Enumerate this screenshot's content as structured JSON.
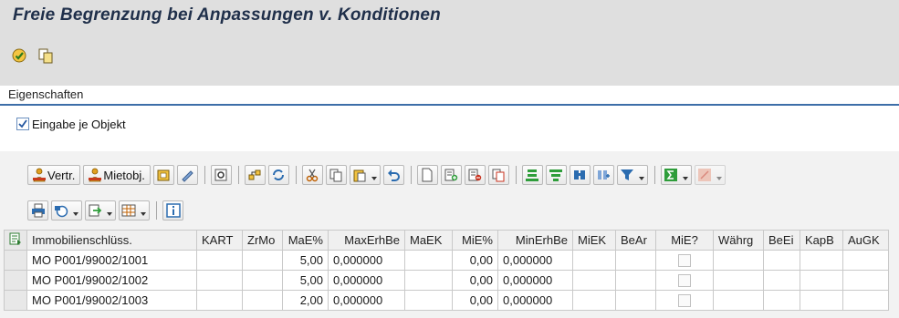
{
  "window": {
    "title": "Freie Begrenzung bei Anpassungen v. Konditionen"
  },
  "app_toolbar": {
    "icons": [
      "execute-icon",
      "copy-icon"
    ]
  },
  "properties": {
    "section_label": "Eigenschaften",
    "checkbox": {
      "label": "Eingabe je Objekt",
      "checked": true
    }
  },
  "toolbar": {
    "vertr_label": "Vertr.",
    "mietobj_label": "Mietobj."
  },
  "table": {
    "columns": [
      "Immobilienschlüss.",
      "KART",
      "ZrMo",
      "MaE%",
      "MaxErhBe",
      "MaEK",
      "MiE%",
      "MinErhBe",
      "MiEK",
      "BeAr",
      "MiE?",
      "Währg",
      "BeEi",
      "KapB",
      "AuGK"
    ],
    "rows": [
      {
        "immo": "MO P001/99002/1001",
        "kart": "",
        "zrmo": "",
        "mae": "5,00",
        "maxerhbe": "0,000000",
        "maek": "",
        "mie": "0,00",
        "minerhbe": "0,000000",
        "miek": "",
        "bear": "",
        "mie_q": false,
        "waehrg": "",
        "beei": "",
        "kapb": "",
        "augk": ""
      },
      {
        "immo": "MO P001/99002/1002",
        "kart": "",
        "zrmo": "",
        "mae": "5,00",
        "maxerhbe": "0,000000",
        "maek": "",
        "mie": "0,00",
        "minerhbe": "0,000000",
        "miek": "",
        "bear": "",
        "mie_q": false,
        "waehrg": "",
        "beei": "",
        "kapb": "",
        "augk": ""
      },
      {
        "immo": "MO P001/99002/1003",
        "kart": "",
        "zrmo": "",
        "mae": "2,00",
        "maxerhbe": "0,000000",
        "maek": "",
        "mie": "0,00",
        "minerhbe": "0,000000",
        "miek": "",
        "bear": "",
        "mie_q": false,
        "waehrg": "",
        "beei": "",
        "kapb": "",
        "augk": ""
      }
    ]
  },
  "colors": {
    "accent": "#3d6ea8",
    "title": "#1f2f4a"
  }
}
